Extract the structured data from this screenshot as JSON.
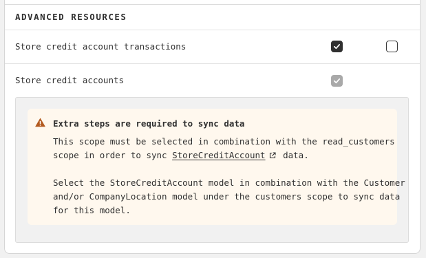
{
  "section": {
    "title": "ADVANCED RESOURCES"
  },
  "rows": [
    {
      "label": "Store credit account transactions",
      "read_checked": true,
      "write_checked": false
    },
    {
      "label": "Store credit accounts",
      "read_checked": true,
      "read_disabled": true
    }
  ],
  "notice": {
    "icon": "warning-icon",
    "title": "Extra steps are required to sync data",
    "p1_line1": "This scope must be selected in combination with the read_customers",
    "p1_line2_pre": "scope in order to sync ",
    "p1_link": "StoreCreditAccount",
    "p1_line2_post": " data.",
    "p2_line1": "Select the StoreCreditAccount model in combination with the Customer",
    "p2_line2": "and/or CompanyLocation model under the customers scope to sync data",
    "p2_line3": "for this model."
  },
  "colors": {
    "warning": "#b35a1f",
    "notice_bg": "#fff8ee",
    "checkbox_dark": "#303030",
    "checkbox_disabled": "#a9a9a9"
  }
}
